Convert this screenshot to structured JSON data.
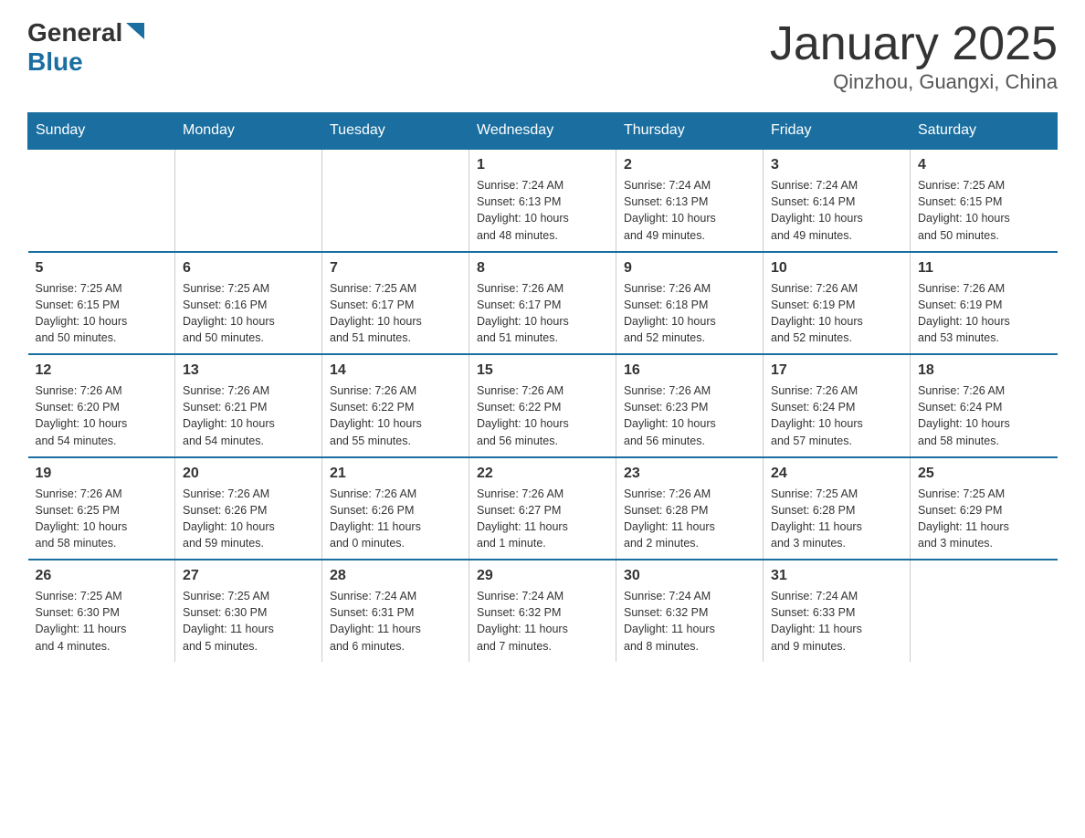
{
  "logo": {
    "general": "General",
    "blue": "Blue",
    "triangle": "▲"
  },
  "title": "January 2025",
  "subtitle": "Qinzhou, Guangxi, China",
  "days_of_week": [
    "Sunday",
    "Monday",
    "Tuesday",
    "Wednesday",
    "Thursday",
    "Friday",
    "Saturday"
  ],
  "weeks": [
    [
      {
        "day": "",
        "info": ""
      },
      {
        "day": "",
        "info": ""
      },
      {
        "day": "",
        "info": ""
      },
      {
        "day": "1",
        "info": "Sunrise: 7:24 AM\nSunset: 6:13 PM\nDaylight: 10 hours\nand 48 minutes."
      },
      {
        "day": "2",
        "info": "Sunrise: 7:24 AM\nSunset: 6:13 PM\nDaylight: 10 hours\nand 49 minutes."
      },
      {
        "day": "3",
        "info": "Sunrise: 7:24 AM\nSunset: 6:14 PM\nDaylight: 10 hours\nand 49 minutes."
      },
      {
        "day": "4",
        "info": "Sunrise: 7:25 AM\nSunset: 6:15 PM\nDaylight: 10 hours\nand 50 minutes."
      }
    ],
    [
      {
        "day": "5",
        "info": "Sunrise: 7:25 AM\nSunset: 6:15 PM\nDaylight: 10 hours\nand 50 minutes."
      },
      {
        "day": "6",
        "info": "Sunrise: 7:25 AM\nSunset: 6:16 PM\nDaylight: 10 hours\nand 50 minutes."
      },
      {
        "day": "7",
        "info": "Sunrise: 7:25 AM\nSunset: 6:17 PM\nDaylight: 10 hours\nand 51 minutes."
      },
      {
        "day": "8",
        "info": "Sunrise: 7:26 AM\nSunset: 6:17 PM\nDaylight: 10 hours\nand 51 minutes."
      },
      {
        "day": "9",
        "info": "Sunrise: 7:26 AM\nSunset: 6:18 PM\nDaylight: 10 hours\nand 52 minutes."
      },
      {
        "day": "10",
        "info": "Sunrise: 7:26 AM\nSunset: 6:19 PM\nDaylight: 10 hours\nand 52 minutes."
      },
      {
        "day": "11",
        "info": "Sunrise: 7:26 AM\nSunset: 6:19 PM\nDaylight: 10 hours\nand 53 minutes."
      }
    ],
    [
      {
        "day": "12",
        "info": "Sunrise: 7:26 AM\nSunset: 6:20 PM\nDaylight: 10 hours\nand 54 minutes."
      },
      {
        "day": "13",
        "info": "Sunrise: 7:26 AM\nSunset: 6:21 PM\nDaylight: 10 hours\nand 54 minutes."
      },
      {
        "day": "14",
        "info": "Sunrise: 7:26 AM\nSunset: 6:22 PM\nDaylight: 10 hours\nand 55 minutes."
      },
      {
        "day": "15",
        "info": "Sunrise: 7:26 AM\nSunset: 6:22 PM\nDaylight: 10 hours\nand 56 minutes."
      },
      {
        "day": "16",
        "info": "Sunrise: 7:26 AM\nSunset: 6:23 PM\nDaylight: 10 hours\nand 56 minutes."
      },
      {
        "day": "17",
        "info": "Sunrise: 7:26 AM\nSunset: 6:24 PM\nDaylight: 10 hours\nand 57 minutes."
      },
      {
        "day": "18",
        "info": "Sunrise: 7:26 AM\nSunset: 6:24 PM\nDaylight: 10 hours\nand 58 minutes."
      }
    ],
    [
      {
        "day": "19",
        "info": "Sunrise: 7:26 AM\nSunset: 6:25 PM\nDaylight: 10 hours\nand 58 minutes."
      },
      {
        "day": "20",
        "info": "Sunrise: 7:26 AM\nSunset: 6:26 PM\nDaylight: 10 hours\nand 59 minutes."
      },
      {
        "day": "21",
        "info": "Sunrise: 7:26 AM\nSunset: 6:26 PM\nDaylight: 11 hours\nand 0 minutes."
      },
      {
        "day": "22",
        "info": "Sunrise: 7:26 AM\nSunset: 6:27 PM\nDaylight: 11 hours\nand 1 minute."
      },
      {
        "day": "23",
        "info": "Sunrise: 7:26 AM\nSunset: 6:28 PM\nDaylight: 11 hours\nand 2 minutes."
      },
      {
        "day": "24",
        "info": "Sunrise: 7:25 AM\nSunset: 6:28 PM\nDaylight: 11 hours\nand 3 minutes."
      },
      {
        "day": "25",
        "info": "Sunrise: 7:25 AM\nSunset: 6:29 PM\nDaylight: 11 hours\nand 3 minutes."
      }
    ],
    [
      {
        "day": "26",
        "info": "Sunrise: 7:25 AM\nSunset: 6:30 PM\nDaylight: 11 hours\nand 4 minutes."
      },
      {
        "day": "27",
        "info": "Sunrise: 7:25 AM\nSunset: 6:30 PM\nDaylight: 11 hours\nand 5 minutes."
      },
      {
        "day": "28",
        "info": "Sunrise: 7:24 AM\nSunset: 6:31 PM\nDaylight: 11 hours\nand 6 minutes."
      },
      {
        "day": "29",
        "info": "Sunrise: 7:24 AM\nSunset: 6:32 PM\nDaylight: 11 hours\nand 7 minutes."
      },
      {
        "day": "30",
        "info": "Sunrise: 7:24 AM\nSunset: 6:32 PM\nDaylight: 11 hours\nand 8 minutes."
      },
      {
        "day": "31",
        "info": "Sunrise: 7:24 AM\nSunset: 6:33 PM\nDaylight: 11 hours\nand 9 minutes."
      },
      {
        "day": "",
        "info": ""
      }
    ]
  ]
}
